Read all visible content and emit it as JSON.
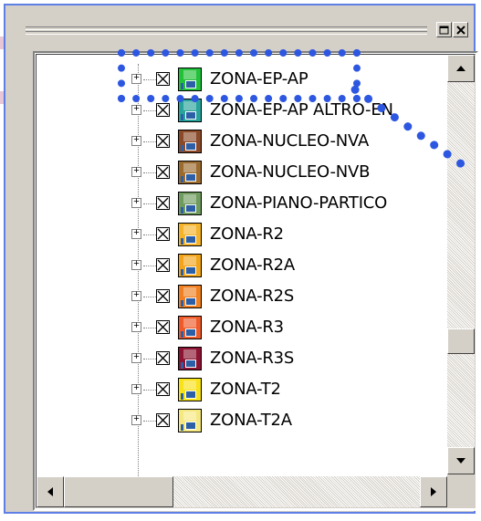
{
  "window": {
    "icons": {
      "restore": "restore-icon",
      "close": "close-icon"
    }
  },
  "tree": {
    "items": [
      {
        "label": "ZONA-EP-AP",
        "color": "#22c13a"
      },
      {
        "label": "ZONA-EP-AP ALTRO-EN",
        "color": "#27a39b"
      },
      {
        "label": "ZONA-NUCLEO-NVA",
        "color": "#8a4a2a"
      },
      {
        "label": "ZONA-NUCLEO-NVB",
        "color": "#9a6a2e"
      },
      {
        "label": "ZONA-PIANO-PARTICO",
        "color": "#6f9b5e"
      },
      {
        "label": "ZONA-R2",
        "color": "#f4b32a"
      },
      {
        "label": "ZONA-R2A",
        "color": "#f2a51c"
      },
      {
        "label": "ZONA-R2S",
        "color": "#f08022"
      },
      {
        "label": "ZONA-R3",
        "color": "#ee5a2a"
      },
      {
        "label": "ZONA-R3S",
        "color": "#8c1432"
      },
      {
        "label": "ZONA-T2",
        "color": "#f8e21a"
      },
      {
        "label": "ZONA-T2A",
        "color": "#f6e880"
      }
    ]
  },
  "accent": "#2d57e0"
}
